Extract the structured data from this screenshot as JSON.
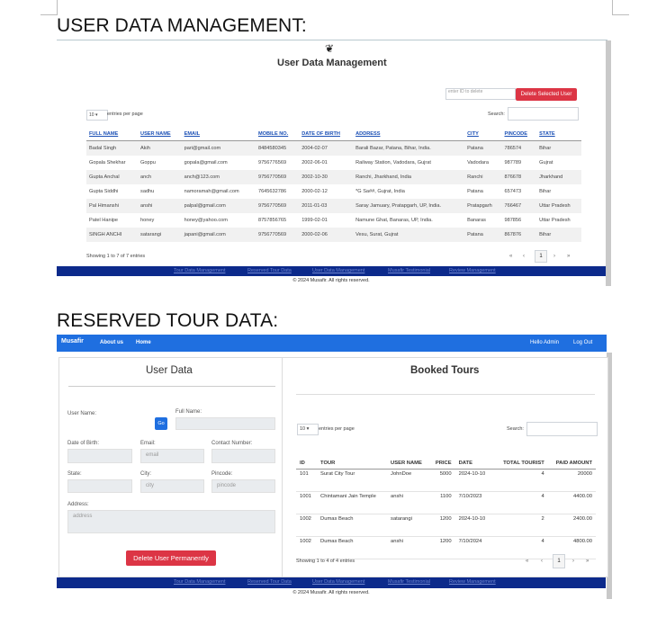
{
  "section1": {
    "heading": "USER DATA MANAGEMENT:"
  },
  "section2": {
    "heading": "RESERVED TOUR DATA:"
  },
  "udm": {
    "title": "User Data Management",
    "delete_input_placeholder": "enter ID to delete",
    "delete_button": "Delete Selected User",
    "entries_value": "10",
    "entries_label": "entries per page",
    "search_label": "Search:",
    "columns": [
      "FULL NAME",
      "USER NAME",
      "EMAIL",
      "MOBILE NO.",
      "DATE OF BIRTH",
      "ADDRESS",
      "CITY",
      "PINCODE",
      "STATE"
    ],
    "rows": [
      [
        "Badal Singh",
        "Akih",
        "pari@gmail.com",
        "8484580345",
        "2004-02-07",
        "Barali Bazar, Patana, Bihar, India.",
        "Patana",
        "786574",
        "Bihar"
      ],
      [
        "Gopala Shekhar",
        "Goppu",
        "gopala@gmail.com",
        "9756776569",
        "2002-06-01",
        "Railway Station, Vadodara, Gujrat",
        "Vadodara",
        "987789",
        "Gujrat"
      ],
      [
        "Gupta Anchal",
        "anch",
        "anch@123.com",
        "9756770569",
        "2002-10-30",
        "Ranchi, Jharkhand, India",
        "Ranchi",
        "876678",
        "Jharkhand"
      ],
      [
        "Gupta Siddhi",
        "sadhu",
        "namoramah@gmail.com",
        "7645632786",
        "2000-02-12",
        "*G Sa##, Gujrat, India",
        "Patana",
        "657473",
        "Bihar"
      ],
      [
        "Pal Himanshi",
        "anshi",
        "palpal@gmail.com",
        "9756770569",
        "2011-01-03",
        "Saray Jamuary, Pratapgarh, UP, India.",
        "Pratapgarh",
        "766467",
        "Uttar Pradesh"
      ],
      [
        "Patel Hanipe",
        "honey",
        "honey@yahoo.com",
        "8757856765",
        "1999-02-01",
        "Namune Ghat, Banaras, UP, India.",
        "Banaras",
        "987856",
        "Uttar Pradesh"
      ],
      [
        "SINGH ANCHI",
        "satarangi",
        "japani@gmail.com",
        "9756770569",
        "2000-02-06",
        "Vesu, Surat, Gujrat",
        "Patana",
        "867876",
        "Bihar"
      ]
    ],
    "showing": "Showing 1 to 7 of 7 entries",
    "pager": {
      "first": "«",
      "prev": "‹",
      "current": "1",
      "next": "›",
      "last": "»"
    },
    "footer_links": [
      "Tour Data Management",
      "Reserved Tour Data",
      "User Data Management",
      "Musafir Testimonial",
      "Review Management"
    ],
    "copyright": "© 2024 Musafir. All rights reserved."
  },
  "rtd": {
    "nav": {
      "brand": "Musafir",
      "about": "About us",
      "home": "Home",
      "admin": "Hello Admin",
      "logout": "Log Out"
    },
    "user_panel": {
      "title": "User Data",
      "username_label": "User Name:",
      "fullname_label": "Full Name:",
      "go_button": "Go",
      "dob_label": "Date of Birth:",
      "email_label": "Email:",
      "email_placeholder": "email",
      "contact_label": "Contact Number:",
      "state_label": "State:",
      "city_label": "City:",
      "city_placeholder": "city",
      "pincode_label": "Pincode:",
      "pincode_placeholder": "pincode",
      "address_label": "Address:",
      "address_placeholder": "address",
      "delete_button": "Delete User Permanently"
    },
    "tours_panel": {
      "title": "Booked Tours",
      "entries_value": "10",
      "entries_label": "entries per page",
      "search_label": "Search:",
      "columns": [
        "ID",
        "TOUR",
        "USER NAME",
        "PRICE",
        "DATE",
        "TOTAL TOURIST",
        "PAID AMOUNT"
      ],
      "rows": [
        [
          "101",
          "Surat City Tour",
          "JohnDoe",
          "5000",
          "2024-10-10",
          "4",
          "20000"
        ],
        [
          "1001",
          "Chintamani Jain Temple",
          "anshi",
          "1100",
          "7/10/2023",
          "4",
          "4400.00"
        ],
        [
          "1002",
          "Dumas Beach",
          "satarangi",
          "1200",
          "2024-10-10",
          "2",
          "2400.00"
        ],
        [
          "1002",
          "Dumas Beach",
          "anshi",
          "1200",
          "7/10/2024",
          "4",
          "4800.00"
        ]
      ],
      "showing": "Showing 1 to 4 of 4 entries",
      "pager": {
        "first": "«",
        "prev": "‹",
        "current": "1",
        "next": "›",
        "last": "»"
      }
    },
    "footer_links": [
      "Tour Data Management",
      "Reserved Tour Data",
      "User Data Management",
      "Musafir Testimonial",
      "Review Management"
    ],
    "copyright": "© 2024 Musafir. All rights reserved."
  }
}
